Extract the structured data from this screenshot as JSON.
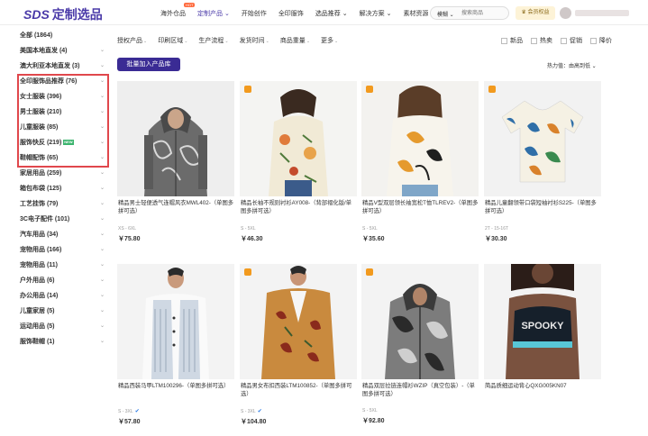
{
  "header": {
    "logo_mark": "SDS",
    "logo_text": "定制选品",
    "nav": [
      {
        "label": "海外仓品",
        "hot": "HOT"
      },
      {
        "label": "定制产品 ⌄"
      },
      {
        "label": "开始创作"
      },
      {
        "label": "全印服饰"
      },
      {
        "label": "选品推荐 ⌄"
      },
      {
        "label": "解决方案 ⌄"
      },
      {
        "label": "素材资源 ⌄"
      }
    ],
    "search_scope": "模糊 ⌄",
    "search_placeholder": "搜索商品",
    "member_label": "会员权益"
  },
  "sidebar": {
    "items": [
      {
        "label": "全部 (1864)",
        "chev": ""
      },
      {
        "label": "美国本地直发 (4)",
        "chev": "⌄"
      },
      {
        "label": "澳大利亚本地直发 (3)",
        "chev": "⌄"
      },
      {
        "label": "全印服饰品推荐 (76)",
        "chev": "⌄"
      },
      {
        "label": "女士服装 (396)",
        "chev": "⌄"
      },
      {
        "label": "男士服装 (210)",
        "chev": "⌄"
      },
      {
        "label": "儿童服装 (85)",
        "chev": "⌄"
      },
      {
        "label": "服饰快反 (219)",
        "chev": "⌄",
        "tag": "NEW"
      },
      {
        "label": "鞋帽配饰 (65)",
        "chev": "⌄"
      },
      {
        "label": "家居用品 (259)",
        "chev": "⌄"
      },
      {
        "label": "箱包布袋 (125)",
        "chev": "⌄"
      },
      {
        "label": "工艺挂饰 (79)",
        "chev": "⌄"
      },
      {
        "label": "3C电子配件 (101)",
        "chev": "⌄"
      },
      {
        "label": "汽车用品 (34)",
        "chev": "⌄"
      },
      {
        "label": "宠物用品 (166)",
        "chev": "⌄"
      },
      {
        "label": "宠物用品 (11)",
        "chev": "⌄"
      },
      {
        "label": "户外用品 (6)",
        "chev": "⌄"
      },
      {
        "label": "办公用品 (14)",
        "chev": "⌄"
      },
      {
        "label": "儿童家居 (5)",
        "chev": "⌄"
      },
      {
        "label": "运动用品 (5)",
        "chev": "⌄"
      },
      {
        "label": "服饰鞋帽 (1)",
        "chev": "⌄"
      }
    ]
  },
  "filters": [
    {
      "label": "授权产品"
    },
    {
      "label": "印刷区域"
    },
    {
      "label": "生产流程"
    },
    {
      "label": "发货时间"
    },
    {
      "label": "商品重量"
    },
    {
      "label": "更多"
    }
  ],
  "filter_arrow": "⌄",
  "checks": [
    {
      "label": "新品"
    },
    {
      "label": "热卖"
    },
    {
      "label": "促销"
    },
    {
      "label": "降价"
    }
  ],
  "batch_button": "批量加入产品库",
  "sort_label": "热力值：由高到低 ⌄",
  "products": [
    {
      "title": "精品男士轻便透气连帽风衣MWL402-（单图多拼可选）",
      "sizes": "XS - 6XL",
      "price": "￥75.80",
      "verified": ""
    },
    {
      "title": "精品长袖不规则衬衫AY008-（背部褶化版/单图多拼可选）",
      "sizes": "S - 5XL",
      "price": "￥46.30",
      "verified": ""
    },
    {
      "title": "精品V型双层领长袖宽松T恤TLREV2-（单图多拼可选）",
      "sizes": "S - 5XL",
      "price": "￥35.60",
      "verified": ""
    },
    {
      "title": "精品儿童翻领带口袋短袖衬衫S225-（单图多拼可选）",
      "sizes": "2T - 15-16T",
      "price": "￥30.30",
      "verified": ""
    },
    {
      "title": "精品西装马甲LTM100296-（单图多拼可选）",
      "sizes": "S - 3XL",
      "price": "￥57.80",
      "verified": "✔"
    },
    {
      "title": "精品男女布扣西装LTM100852-（单图多拼可选）",
      "sizes": "S - 3XL",
      "price": "￥104.80",
      "verified": "✔"
    },
    {
      "title": "精品双层拉链连帽衫WZIP（真空包装）-（单图多拼可选）",
      "sizes": "S - 5XL",
      "price": "￥92.80",
      "verified": ""
    },
    {
      "title": "简品质细运动背心QXG005KN07",
      "sizes": "",
      "price": "",
      "verified": ""
    }
  ],
  "print_text": "SPOOKY",
  "colors": {
    "brand": "#4a3aa8",
    "primary_button": "#3a2b94",
    "highlight_border": "#e0474c",
    "hot_badge": "#ff6a3d",
    "card_badge": "#f29a1e"
  }
}
